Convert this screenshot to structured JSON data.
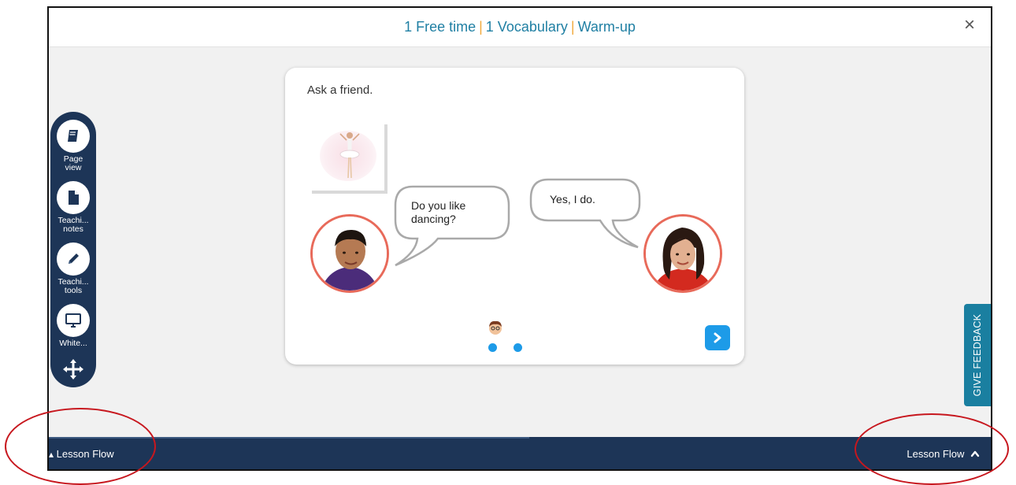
{
  "header": {
    "title_part1": "1 Free time",
    "separator": "|",
    "title_part2": "1 Vocabulary",
    "title_part3": "Warm-up",
    "close_label": "×"
  },
  "toolbar": {
    "items": [
      {
        "label": "Page\nview",
        "icon": "book-icon"
      },
      {
        "label": "Teachi...\nnotes",
        "icon": "document-icon"
      },
      {
        "label": "Teachi...\ntools",
        "icon": "pencil-icon"
      },
      {
        "label": "White...",
        "icon": "monitor-icon"
      }
    ],
    "move_icon": "move-arrows-icon"
  },
  "activity": {
    "prompt": "Ask a friend.",
    "question": "Do you like dancing?",
    "answer": "Yes, I do.",
    "page_dots": 2
  },
  "feedback_label": "GIVE FEEDBACK",
  "footer": {
    "left_label": "Lesson Flow",
    "right_label": "Lesson Flow"
  },
  "colors": {
    "title": "#1f7fa3",
    "separator": "#f2a93b",
    "nav_dark": "#1d3557",
    "accent_blue": "#1d9be8",
    "feedback": "#1a7fa0",
    "avatar_ring": "#e86a5a",
    "annotation": "#c7171e"
  }
}
